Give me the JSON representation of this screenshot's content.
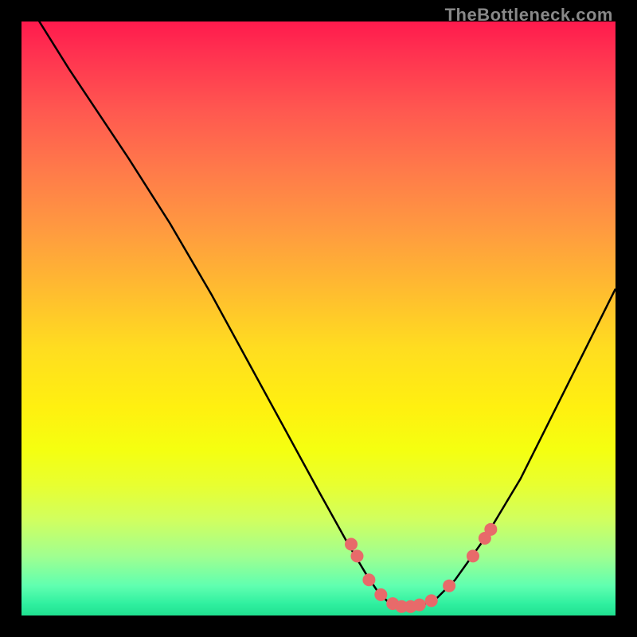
{
  "watermark": "TheBottleneck.com",
  "chart_data": {
    "type": "line",
    "title": "",
    "xlabel": "",
    "ylabel": "",
    "xlim": [
      0,
      100
    ],
    "ylim": [
      0,
      100
    ],
    "series": [
      {
        "name": "curve",
        "x": [
          0,
          3,
          8,
          12,
          18,
          25,
          32,
          38,
          44,
          50,
          55,
          58,
          60,
          62,
          64,
          66,
          68,
          70,
          73,
          78,
          84,
          90,
          96,
          100
        ],
        "y": [
          105,
          100,
          92,
          86,
          77,
          66,
          54,
          43,
          32,
          21,
          12,
          7,
          4,
          2,
          1.5,
          1.5,
          2,
          3,
          6,
          13,
          23,
          35,
          47,
          55
        ]
      }
    ],
    "dots": [
      {
        "x": 55.5,
        "y": 12
      },
      {
        "x": 56.5,
        "y": 10
      },
      {
        "x": 58.5,
        "y": 6
      },
      {
        "x": 60.5,
        "y": 3.5
      },
      {
        "x": 62.5,
        "y": 2
      },
      {
        "x": 64,
        "y": 1.5
      },
      {
        "x": 65.5,
        "y": 1.5
      },
      {
        "x": 67,
        "y": 1.8
      },
      {
        "x": 69,
        "y": 2.5
      },
      {
        "x": 72,
        "y": 5
      },
      {
        "x": 76,
        "y": 10
      },
      {
        "x": 78,
        "y": 13
      },
      {
        "x": 79,
        "y": 14.5
      }
    ],
    "colors": {
      "curve": "#000000",
      "dots": "#e86a6a"
    }
  }
}
